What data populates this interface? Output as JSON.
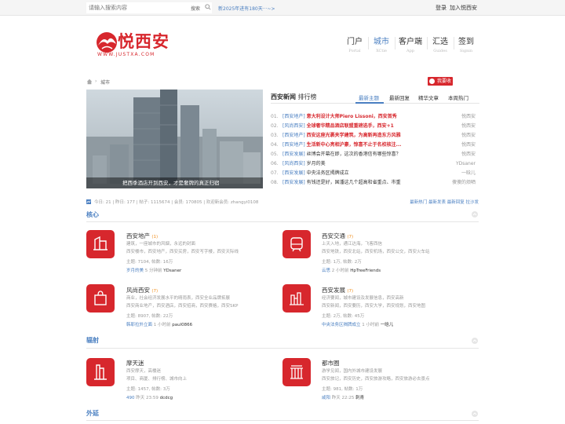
{
  "topbar": {
    "search_placeholder": "请输入搜索内容",
    "search_button": "搜索",
    "notice": "新2025年进有180天···~>",
    "login": "登录",
    "join": "加入悦西安"
  },
  "logo": {
    "name": "悦西安",
    "url": "WWW.JUSTXA.COM"
  },
  "nav": [
    {
      "cn": "门户",
      "en": "Portal"
    },
    {
      "cn": "城市",
      "en": "XCtie"
    },
    {
      "cn": "客户端",
      "en": "App"
    },
    {
      "cn": "汇选",
      "en": "Guides"
    },
    {
      "cn": "签到",
      "en": "Signin"
    }
  ],
  "breadcrumb": {
    "current": "城市",
    "separator": "›"
  },
  "collect_button": "我要收藏",
  "slide_caption": "把西季酒店开到西安，才是奢牌的真正归宿",
  "news": {
    "title_strong": "西安新闻",
    "title_rest": " 排行榜",
    "tabs": [
      "最新主题",
      "最新回复",
      "精华文章",
      "本周热门"
    ],
    "items": [
      {
        "num": "01.",
        "cat": "[西安地产]",
        "title": "意大利设计大师Piero Lissoni，西安首秀",
        "author": "悦西安",
        "hot": true
      },
      {
        "num": "02.",
        "cat": "[风尚西安]",
        "title": "全球奢华精品酒店联盟重磅选手，西安+1",
        "author": "悦西安",
        "hot": true
      },
      {
        "num": "03.",
        "cat": "[西安地产]",
        "title": "西安这座光裹夹学建筑，为高新再造东方风雅",
        "author": "悦西安",
        "hot": true
      },
      {
        "num": "04.",
        "cat": "[西安地产]",
        "title": "生活新中心亮相沪豪，惊喜不止于名校核注...",
        "author": "悦西安",
        "hot": true
      },
      {
        "num": "05.",
        "cat": "[西安发展]",
        "title": "丝博会开幕在即，这次的香港信有哪些惊喜？",
        "author": "悦西安",
        "hot": false
      },
      {
        "num": "06.",
        "cat": "[风尚西安]",
        "title": "岁月的美",
        "author": "YDsaner",
        "hot": false
      },
      {
        "num": "07.",
        "cat": "[西安发展]",
        "title": "中央法务区揭牌成立",
        "author": "一晗儿",
        "hot": false
      },
      {
        "num": "08.",
        "cat": "[西安发展]",
        "title": "有钱还是好，国潘这几个超高和省重点、市重",
        "author": "傻傻的烦晒",
        "hot": false
      }
    ]
  },
  "stats": {
    "text": "今日: 21 | 昨日: 177 | 帖子: 1115674 | 会员: 170805 | 欢迎新会员: zhangyi0108",
    "links": "最新热门 最新发表 最新回复 拉沙发"
  },
  "sections": [
    {
      "title": "核心",
      "forums": [
        {
          "name": "西安地产",
          "badge": "(1)",
          "desc1": "建筑，一座城市的风烟，永远的封面",
          "desc2": "西安楼市，西安地产，西安买房，西安写字楼，西安天际线",
          "stat": "主题: 7104, 帖数: 16万",
          "last_link": "岁月的美",
          "last_time": "5 分钟前",
          "last_user": "YDsaner"
        },
        {
          "name": "西安交通",
          "badge": "(7)",
          "desc1": "上天入地，通江达海，飞客西信",
          "desc2": "西安地铁，西安北站，西安机场，西安公交，西安火车站",
          "stat": "主题: 1万, 帖数: 2万",
          "last_link": "云思",
          "last_time": "2 小时前",
          "last_user": "HpTreeFriends"
        },
        {
          "name": "风尚西安",
          "badge": "(7)",
          "desc1": "商业，社会经济发展水平的晴雨表，西安全业品牌拓展",
          "desc2": "西安商业地产，西安酒店，西安招商，西安赛格，西安SKP",
          "stat": "主题: 8907, 帖数: 22万",
          "last_link": "韩耶拉外立面",
          "last_time": "1 小时前",
          "last_user": "paul0866"
        },
        {
          "name": "西安发展",
          "badge": "(7)",
          "desc1": "经济要闻，城市建设及发展信息，西安高新",
          "desc2": "西安新闻，西安要历，西安大学，西安规划，西安地图",
          "stat": "主题: 2万, 帖数: 45万",
          "last_link": "中央法务区揭牌成立",
          "last_time": "1 小时前",
          "last_user": "一晗儿"
        }
      ]
    },
    {
      "title": "辐射",
      "forums": [
        {
          "name": "摩天迷",
          "badge": "",
          "desc1": "西安摩天，高楼迷",
          "desc2": "项目、商厦、排行榜、城市向上",
          "stat": "主题: 1457, 帖数: 3万",
          "last_link": "490",
          "last_time": "昨天 23:59",
          "last_user": "dcdcg"
        },
        {
          "name": "都市圈",
          "badge": "",
          "desc1": "游学见闻，国内外城市建设发展",
          "desc2": "西安旅记，西安历史，西安旅游攻略，西安旅游必去景点",
          "stat": "主题: 981, 帖数: 1万",
          "last_link": "咸阳",
          "last_time": "昨天 22:25",
          "last_user": "刺青"
        }
      ]
    },
    {
      "title": "外延",
      "forums": []
    }
  ],
  "colors": {
    "brand_red": "#d7272d",
    "link_blue": "#4a7fc1"
  }
}
